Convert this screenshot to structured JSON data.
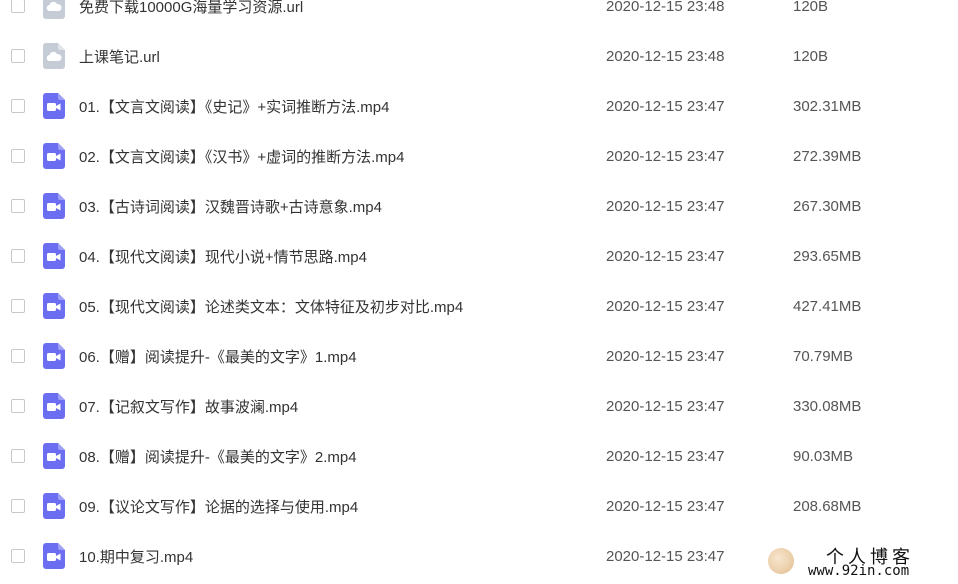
{
  "files": [
    {
      "name": "免费下载10000G海量学习资源.url",
      "date": "2020-12-15 23:48",
      "size": "120B",
      "type": "url",
      "icon": "cloud-file-icon"
    },
    {
      "name": "上课笔记.url",
      "date": "2020-12-15 23:48",
      "size": "120B",
      "type": "url",
      "icon": "cloud-file-icon"
    },
    {
      "name": "01.【文言文阅读】《史记》+实词推断方法.mp4",
      "date": "2020-12-15 23:47",
      "size": "302.31MB",
      "type": "video",
      "icon": "video-file-icon"
    },
    {
      "name": "02.【文言文阅读】《汉书》+虚词的推断方法.mp4",
      "date": "2020-12-15 23:47",
      "size": "272.39MB",
      "type": "video",
      "icon": "video-file-icon"
    },
    {
      "name": "03.【古诗词阅读】汉魏晋诗歌+古诗意象.mp4",
      "date": "2020-12-15 23:47",
      "size": "267.30MB",
      "type": "video",
      "icon": "video-file-icon"
    },
    {
      "name": "04.【现代文阅读】现代小说+情节思路.mp4",
      "date": "2020-12-15 23:47",
      "size": "293.65MB",
      "type": "video",
      "icon": "video-file-icon"
    },
    {
      "name": "05.【现代文阅读】论述类文本：文体特征及初步对比.mp4",
      "date": "2020-12-15 23:47",
      "size": "427.41MB",
      "type": "video",
      "icon": "video-file-icon"
    },
    {
      "name": "06.【赠】阅读提升-《最美的文字》1.mp4",
      "date": "2020-12-15 23:47",
      "size": "70.79MB",
      "type": "video",
      "icon": "video-file-icon"
    },
    {
      "name": "07.【记叙文写作】故事波澜.mp4",
      "date": "2020-12-15 23:47",
      "size": "330.08MB",
      "type": "video",
      "icon": "video-file-icon"
    },
    {
      "name": "08.【赠】阅读提升-《最美的文字》2.mp4",
      "date": "2020-12-15 23:47",
      "size": "90.03MB",
      "type": "video",
      "icon": "video-file-icon"
    },
    {
      "name": "09.【议论文写作】论据的选择与使用.mp4",
      "date": "2020-12-15 23:47",
      "size": "208.68MB",
      "type": "video",
      "icon": "video-file-icon"
    },
    {
      "name": "10.期中复习.mp4",
      "date": "2020-12-15 23:47",
      "size": "",
      "type": "video",
      "icon": "video-file-icon"
    }
  ],
  "watermark": {
    "title": "个人博客",
    "url": "www.92in.com"
  },
  "colors": {
    "video_icon": "#6b6ef0",
    "cloud_icon": "#c5ccd6",
    "text": "#333333",
    "meta_text": "#555555",
    "checkbox_border": "#c8c8c8"
  }
}
